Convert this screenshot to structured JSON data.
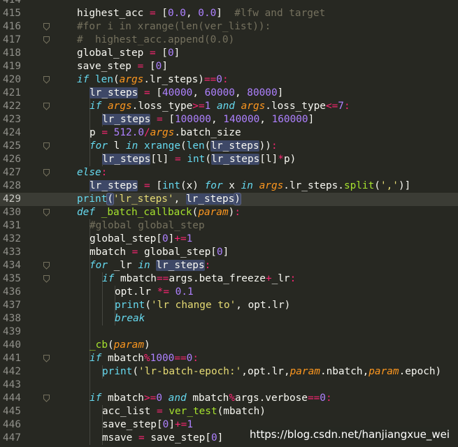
{
  "editor": {
    "theme_colors": {
      "background": "#272822",
      "foreground": "#f8f8f2",
      "keyword": "#66d9ef",
      "function": "#a6e22e",
      "operator": "#f92672",
      "number": "#ae81ff",
      "string": "#e6db74",
      "comment": "#75715e",
      "parameter": "#fd971f"
    },
    "active_line": 429,
    "watermark": "https://blog.csdn.net/hanjiangxue_wei",
    "lines": [
      {
        "n": 414,
        "indent": 1,
        "fold": false,
        "toks": []
      },
      {
        "n": 415,
        "indent": 1,
        "fold": false,
        "toks": [
          [
            "",
            "highest_acc "
          ],
          [
            "op",
            "="
          ],
          [
            "",
            " ["
          ],
          [
            "num",
            "0.0"
          ],
          [
            "",
            ", "
          ],
          [
            "num",
            "0.0"
          ],
          [
            "",
            "]  "
          ],
          [
            "cm",
            "#lfw and target"
          ]
        ]
      },
      {
        "n": 416,
        "indent": 1,
        "fold": true,
        "toks": [
          [
            "cm",
            "#for i in xrange(len(ver_list)):"
          ]
        ]
      },
      {
        "n": 417,
        "indent": 1,
        "fold": true,
        "toks": [
          [
            "cm",
            "#  highest_acc.append(0.0)"
          ]
        ]
      },
      {
        "n": 418,
        "indent": 1,
        "fold": false,
        "toks": [
          [
            "",
            "global_step "
          ],
          [
            "op",
            "="
          ],
          [
            "",
            " ["
          ],
          [
            "num",
            "0"
          ],
          [
            "",
            "]"
          ]
        ]
      },
      {
        "n": 419,
        "indent": 1,
        "fold": false,
        "toks": [
          [
            "",
            "save_step "
          ],
          [
            "op",
            "="
          ],
          [
            "",
            " ["
          ],
          [
            "num",
            "0"
          ],
          [
            "",
            "]"
          ]
        ]
      },
      {
        "n": 420,
        "indent": 1,
        "fold": true,
        "toks": [
          [
            "kw",
            "if"
          ],
          [
            "",
            " "
          ],
          [
            "bi",
            "len"
          ],
          [
            "",
            "("
          ],
          [
            "prm",
            "args"
          ],
          [
            "",
            ".lr_steps)"
          ],
          [
            "op",
            "=="
          ],
          [
            "num",
            "0"
          ],
          [
            "op",
            ":"
          ]
        ]
      },
      {
        "n": 421,
        "indent": 2,
        "fold": false,
        "toks": [
          [
            "hl",
            "lr_steps"
          ],
          [
            "",
            " "
          ],
          [
            "op",
            "="
          ],
          [
            "",
            " ["
          ],
          [
            "num",
            "40000"
          ],
          [
            "",
            ", "
          ],
          [
            "num",
            "60000"
          ],
          [
            "",
            ", "
          ],
          [
            "num",
            "80000"
          ],
          [
            "",
            "]"
          ]
        ]
      },
      {
        "n": 422,
        "indent": 2,
        "fold": true,
        "toks": [
          [
            "kw",
            "if"
          ],
          [
            "",
            " "
          ],
          [
            "prm",
            "args"
          ],
          [
            "",
            ".loss_type"
          ],
          [
            "op",
            ">="
          ],
          [
            "num",
            "1"
          ],
          [
            "",
            " "
          ],
          [
            "kw",
            "and"
          ],
          [
            "",
            " "
          ],
          [
            "prm",
            "args"
          ],
          [
            "",
            ".loss_type"
          ],
          [
            "op",
            "<="
          ],
          [
            "num",
            "7"
          ],
          [
            "op",
            ":"
          ]
        ]
      },
      {
        "n": 423,
        "indent": 3,
        "fold": false,
        "toks": [
          [
            "hl",
            "lr_steps"
          ],
          [
            "",
            " "
          ],
          [
            "op",
            "="
          ],
          [
            "",
            " ["
          ],
          [
            "num",
            "100000"
          ],
          [
            "",
            ", "
          ],
          [
            "num",
            "140000"
          ],
          [
            "",
            ", "
          ],
          [
            "num",
            "160000"
          ],
          [
            "",
            "]"
          ]
        ]
      },
      {
        "n": 424,
        "indent": 2,
        "fold": false,
        "toks": [
          [
            "",
            "p "
          ],
          [
            "op",
            "="
          ],
          [
            "",
            " "
          ],
          [
            "num",
            "512.0"
          ],
          [
            "op",
            "/"
          ],
          [
            "prm",
            "args"
          ],
          [
            "",
            ".batch_size"
          ]
        ]
      },
      {
        "n": 425,
        "indent": 2,
        "fold": true,
        "toks": [
          [
            "kw",
            "for"
          ],
          [
            "",
            " l "
          ],
          [
            "kw",
            "in"
          ],
          [
            "",
            " "
          ],
          [
            "bi",
            "xrange"
          ],
          [
            "",
            "("
          ],
          [
            "bi",
            "len"
          ],
          [
            "",
            "("
          ],
          [
            "hl",
            "lr_steps"
          ],
          [
            "",
            "))"
          ],
          [
            "op",
            ":"
          ]
        ]
      },
      {
        "n": 426,
        "indent": 3,
        "fold": false,
        "toks": [
          [
            "hl",
            "lr_steps"
          ],
          [
            "",
            "[l] "
          ],
          [
            "op",
            "="
          ],
          [
            "",
            " "
          ],
          [
            "bi",
            "int"
          ],
          [
            "",
            "("
          ],
          [
            "hl",
            "lr_steps"
          ],
          [
            "",
            "[l]"
          ],
          [
            "op",
            "*"
          ],
          [
            "",
            "p)"
          ]
        ]
      },
      {
        "n": 427,
        "indent": 1,
        "fold": true,
        "toks": [
          [
            "kw",
            "else"
          ],
          [
            "op",
            ":"
          ]
        ]
      },
      {
        "n": 428,
        "indent": 2,
        "fold": false,
        "toks": [
          [
            "hl",
            "lr_steps"
          ],
          [
            "",
            " "
          ],
          [
            "op",
            "="
          ],
          [
            "",
            " ["
          ],
          [
            "bi",
            "int"
          ],
          [
            "",
            "(x) "
          ],
          [
            "kw",
            "for"
          ],
          [
            "",
            " x "
          ],
          [
            "kw",
            "in"
          ],
          [
            "",
            " "
          ],
          [
            "prm",
            "args"
          ],
          [
            "",
            ".lr_steps."
          ],
          [
            "fn",
            "split"
          ],
          [
            "",
            "("
          ],
          [
            "str",
            "','"
          ],
          [
            "",
            ")]"
          ]
        ]
      },
      {
        "n": 429,
        "indent": 1,
        "fold": false,
        "toks": [
          [
            "bi",
            "print"
          ],
          [
            "hl2",
            "("
          ],
          [
            "str",
            "'lr_steps'"
          ],
          [
            "",
            ", "
          ],
          [
            "hl",
            "lr_steps"
          ],
          [
            "hl2",
            ")"
          ]
        ]
      },
      {
        "n": 430,
        "indent": 1,
        "fold": true,
        "toks": [
          [
            "kw",
            "def"
          ],
          [
            "",
            " "
          ],
          [
            "fn",
            "_batch_callback"
          ],
          [
            "",
            "("
          ],
          [
            "prm",
            "param"
          ],
          [
            "",
            ")"
          ],
          [
            "op",
            ":"
          ]
        ]
      },
      {
        "n": 431,
        "indent": 2,
        "fold": false,
        "toks": [
          [
            "cm",
            "#global global_step"
          ]
        ]
      },
      {
        "n": 432,
        "indent": 2,
        "fold": false,
        "toks": [
          [
            "",
            "global_step["
          ],
          [
            "num",
            "0"
          ],
          [
            "",
            "]"
          ],
          [
            "op",
            "+="
          ],
          [
            "num",
            "1"
          ]
        ]
      },
      {
        "n": 433,
        "indent": 2,
        "fold": false,
        "toks": [
          [
            "",
            "mbatch "
          ],
          [
            "op",
            "="
          ],
          [
            "",
            " global_step["
          ],
          [
            "num",
            "0"
          ],
          [
            "",
            "]"
          ]
        ]
      },
      {
        "n": 434,
        "indent": 2,
        "fold": true,
        "toks": [
          [
            "kw",
            "for"
          ],
          [
            "",
            " _lr "
          ],
          [
            "kw",
            "in"
          ],
          [
            "",
            " "
          ],
          [
            "hl",
            "lr_steps"
          ],
          [
            "op",
            ":"
          ]
        ]
      },
      {
        "n": 435,
        "indent": 3,
        "fold": true,
        "toks": [
          [
            "kw",
            "if"
          ],
          [
            "",
            " mbatch"
          ],
          [
            "op",
            "=="
          ],
          [
            "",
            "args.beta_freeze"
          ],
          [
            "op",
            "+"
          ],
          [
            "",
            "_lr"
          ],
          [
            "op",
            ":"
          ]
        ]
      },
      {
        "n": 436,
        "indent": 4,
        "fold": false,
        "toks": [
          [
            "",
            "opt.lr "
          ],
          [
            "op",
            "*="
          ],
          [
            "",
            " "
          ],
          [
            "num",
            "0.1"
          ]
        ]
      },
      {
        "n": 437,
        "indent": 4,
        "fold": false,
        "toks": [
          [
            "bi",
            "print"
          ],
          [
            "",
            "("
          ],
          [
            "str",
            "'lr change to'"
          ],
          [
            "",
            ", opt.lr)"
          ]
        ]
      },
      {
        "n": 438,
        "indent": 4,
        "fold": false,
        "toks": [
          [
            "kw",
            "break"
          ]
        ]
      },
      {
        "n": 439,
        "indent": 2,
        "fold": false,
        "toks": []
      },
      {
        "n": 440,
        "indent": 2,
        "fold": false,
        "toks": [
          [
            "fn",
            "_cb"
          ],
          [
            "",
            "("
          ],
          [
            "prm",
            "param"
          ],
          [
            "",
            ")"
          ]
        ]
      },
      {
        "n": 441,
        "indent": 2,
        "fold": true,
        "toks": [
          [
            "kw",
            "if"
          ],
          [
            "",
            " mbatch"
          ],
          [
            "op",
            "%"
          ],
          [
            "num",
            "1000"
          ],
          [
            "op",
            "=="
          ],
          [
            "num",
            "0"
          ],
          [
            "op",
            ":"
          ]
        ]
      },
      {
        "n": 442,
        "indent": 3,
        "fold": false,
        "toks": [
          [
            "bi",
            "print"
          ],
          [
            "",
            "("
          ],
          [
            "str",
            "'lr-batch-epoch:'"
          ],
          [
            "",
            ",opt.lr,"
          ],
          [
            "prm",
            "param"
          ],
          [
            "",
            ".nbatch,"
          ],
          [
            "prm",
            "param"
          ],
          [
            "",
            ".epoch)"
          ]
        ]
      },
      {
        "n": 443,
        "indent": 2,
        "fold": false,
        "toks": []
      },
      {
        "n": 444,
        "indent": 2,
        "fold": true,
        "toks": [
          [
            "kw",
            "if"
          ],
          [
            "",
            " mbatch"
          ],
          [
            "op",
            ">="
          ],
          [
            "num",
            "0"
          ],
          [
            "",
            " "
          ],
          [
            "kw",
            "and"
          ],
          [
            "",
            " mbatch"
          ],
          [
            "op",
            "%"
          ],
          [
            "",
            "args.verbose"
          ],
          [
            "op",
            "=="
          ],
          [
            "num",
            "0"
          ],
          [
            "op",
            ":"
          ]
        ]
      },
      {
        "n": 445,
        "indent": 3,
        "fold": false,
        "toks": [
          [
            "",
            "acc_list "
          ],
          [
            "op",
            "="
          ],
          [
            "",
            " "
          ],
          [
            "fn",
            "ver_test"
          ],
          [
            "",
            "(mbatch)"
          ]
        ]
      },
      {
        "n": 446,
        "indent": 3,
        "fold": false,
        "toks": [
          [
            "",
            "save_step["
          ],
          [
            "num",
            "0"
          ],
          [
            "",
            "]"
          ],
          [
            "op",
            "+="
          ],
          [
            "num",
            "1"
          ]
        ]
      },
      {
        "n": 447,
        "indent": 3,
        "fold": false,
        "toks": [
          [
            "",
            "msave "
          ],
          [
            "op",
            "="
          ],
          [
            "",
            " save_step["
          ],
          [
            "num",
            "0"
          ],
          [
            "",
            "]"
          ]
        ]
      }
    ]
  }
}
